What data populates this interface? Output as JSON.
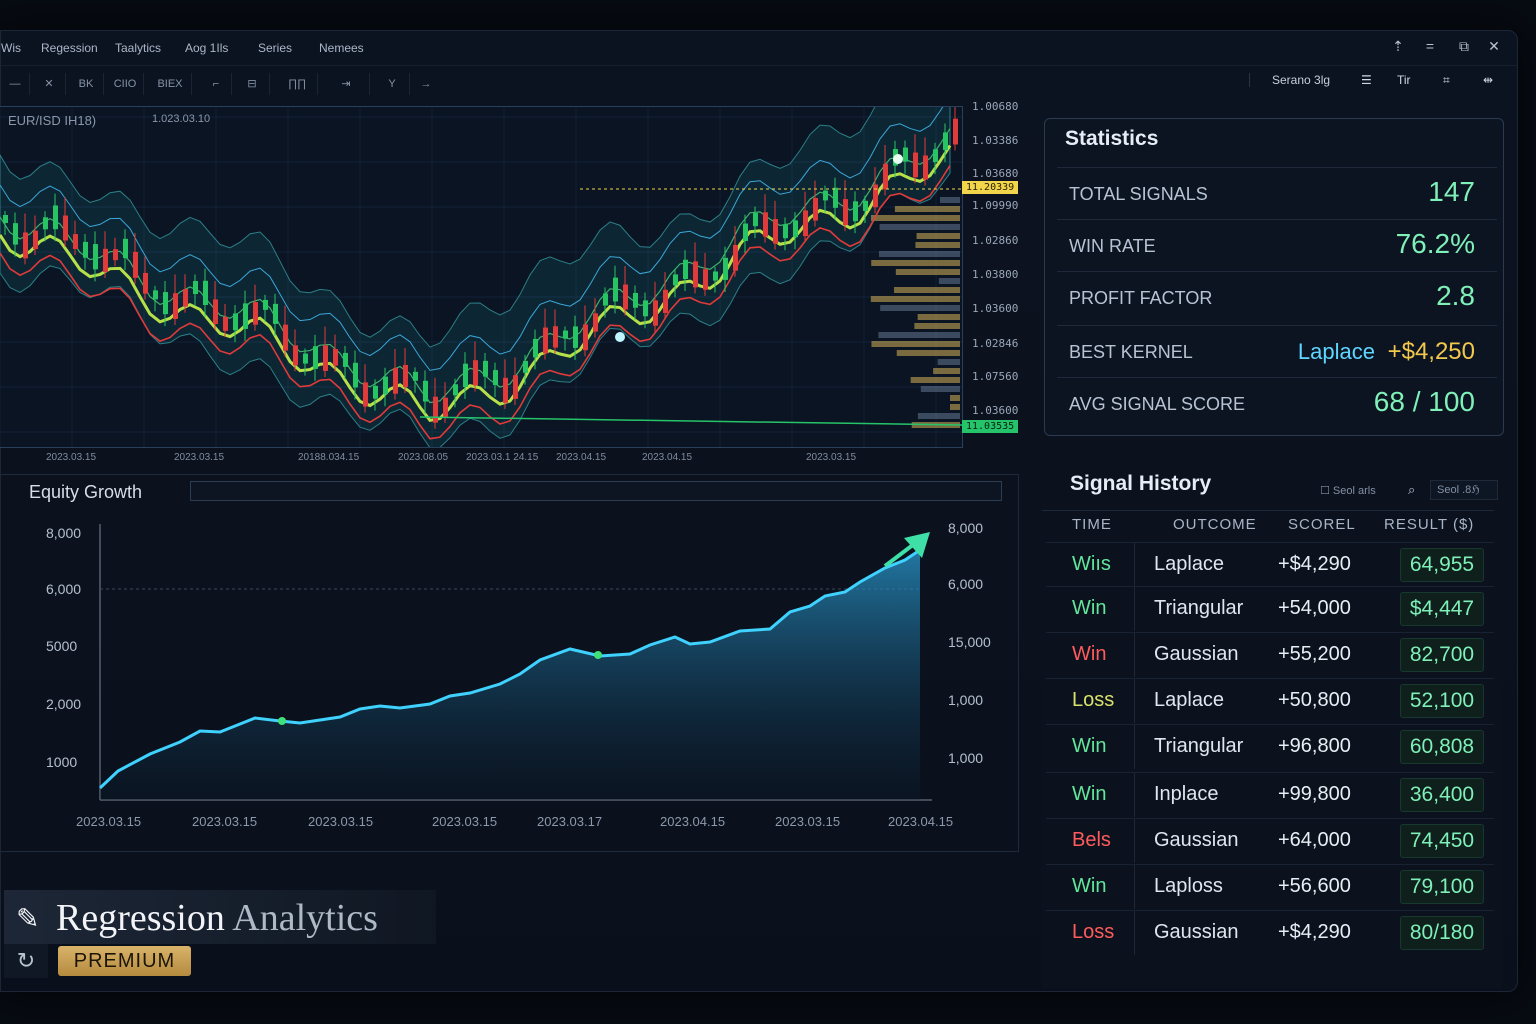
{
  "menu": [
    "Wis",
    "Regession",
    "Taalytics",
    "Aog 1Ils",
    "Series",
    "Nemees"
  ],
  "toolbar": [
    "—",
    "✕",
    "BK",
    "CIIO",
    "BIEX",
    "⌐",
    "⊟",
    "∏∏",
    "⇥",
    "Y",
    "→"
  ],
  "right_tools": {
    "search_label": "Serano 3lg",
    "tool2": "Tir"
  },
  "chart": {
    "symbol": "EUR/ISD  IH18)",
    "date": "1.023.03.10",
    "y_labels": [
      "1.00680",
      "1.03386",
      "1.03680",
      "1.09990",
      "1.02860",
      "1.03800",
      "1.03600",
      "1.02846",
      "1.07560",
      "1.03600"
    ],
    "price_tag_top": "11.20339",
    "price_tag_bottom": "11.03535",
    "x_labels": [
      "2023.03.15",
      "2023.03.15",
      "20188.034.15",
      "2023.08.05",
      "2023.03.1 24.15",
      "2023.04.15",
      "2023.04.15",
      "2023.03.15"
    ]
  },
  "equity": {
    "title": "Equity Growth",
    "y_left": [
      "8,000",
      "6,000",
      "5000",
      "2,000",
      "1000"
    ],
    "y_right": [
      "8,000",
      "6,000",
      "15,000",
      "1,000",
      "1,000"
    ],
    "x_labels": [
      "2023.03.15",
      "2023.03.15",
      "2023.03.15",
      "2023.03.15",
      "2023.03.17",
      "2023.04.15",
      "2023.03.15",
      "2023.04.15"
    ]
  },
  "stats": {
    "title": "Statistics",
    "rows": [
      {
        "label": "TOTAL SIGNALS",
        "value": "147"
      },
      {
        "label": "WIN RATE",
        "value": "76.2%"
      },
      {
        "label": "PROFIT FACTOR",
        "value": "2.8"
      },
      {
        "label": "BEST KERNEL",
        "value": "+$4,250",
        "kernel": "Laplace"
      },
      {
        "label": "AVG SIGNAL SCORE",
        "value": "68 / 100"
      }
    ],
    "colors": {
      "value": "#7ff0b8",
      "kernel": "#5fd6ff",
      "gold": "#f2c94c"
    }
  },
  "history": {
    "title": "Signal History",
    "search_label": "Seol .8ℌ",
    "checkbox_label": "Seol arls",
    "headers": [
      "TIME",
      "OUTCOME",
      "SCOREL",
      "RESULT ($)"
    ],
    "rows": [
      {
        "time": "Wiıs",
        "outcome": "Laplace",
        "score": "+$4,290",
        "result": "64,955",
        "status": "win"
      },
      {
        "time": "Win",
        "outcome": "Triangular",
        "score": "+54,000",
        "result": "$4,447",
        "status": "win"
      },
      {
        "time": "Win",
        "outcome": "Gaussian",
        "score": "+55,200",
        "result": "82,700",
        "status": "loss"
      },
      {
        "time": "Loss",
        "outcome": "Laplace",
        "score": "+50,800",
        "result": "52,100",
        "status": "amber"
      },
      {
        "time": "Win",
        "outcome": "Triangular",
        "score": "+96,800",
        "result": "60,808",
        "status": "win"
      },
      {
        "time": "Win",
        "outcome": "Inplace",
        "score": "+99,800",
        "result": "36,400",
        "status": "win"
      },
      {
        "time": "Bels",
        "outcome": "Gaussian",
        "score": "+64,000",
        "result": "74,450",
        "status": "loss"
      },
      {
        "time": "Win",
        "outcome": "Laploss",
        "score": "+56,600",
        "result": "79,100",
        "status": "win"
      },
      {
        "time": "Loss",
        "outcome": "Gaussian",
        "score": "+$4,290",
        "result": "80/180",
        "status": "loss"
      }
    ],
    "status_colors": {
      "win": "#62e69a",
      "loss": "#ff5b5b",
      "amber": "#d9e26a"
    }
  },
  "brand": {
    "name_a": "Regression",
    "name_b": "Analytics",
    "badge": "PREMIUM"
  }
}
